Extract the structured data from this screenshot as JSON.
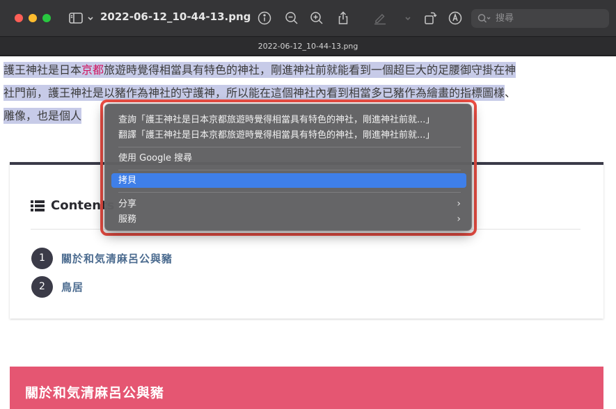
{
  "window": {
    "title": "2022-06-12_10-44-13.png",
    "tab_title": "2022-06-12_10-44-13.png"
  },
  "toolbar": {
    "icons": [
      "sidebar-icon",
      "chevron-down-icon",
      "info-icon",
      "zoom-out-icon",
      "zoom-in-icon",
      "share-icon",
      "markup-pen-icon",
      "chevron-down-icon",
      "rotate-icon",
      "markup-circle-icon"
    ],
    "search_placeholder": "搜尋"
  },
  "document": {
    "line1_hl_a": "護王神社是日本",
    "line1_kw": "京都",
    "line1_hl_b": "旅遊時覺得相當具有特色的神社，剛進神社前就能看到一個超巨大的足腰御守掛在神",
    "line2_hl": "社門前，護王神社是以豬作為神社的守護神，所以能在這個神社內看到相當多已豬作為繪畫的指標圖樣",
    "line2_tail": "、",
    "line3_hl": "雕像，也是個人",
    "toc": {
      "title": "Contents",
      "items": [
        {
          "number": "1",
          "label": "關於和気清麻呂公與豬"
        },
        {
          "number": "2",
          "label": "鳥居"
        }
      ]
    },
    "section_heading": "關於和気清麻呂公與豬"
  },
  "context_menu": {
    "lookup": "查詢「護王神社是日本京都旅遊時覺得相當具有特色的神社，剛進神社前就...」",
    "translate": "翻譯「護王神社是日本京都旅遊時覺得相當具有特色的神社，剛進神社前就...」",
    "google_search": "使用 Google 搜尋",
    "copy": "拷貝",
    "share": "分享",
    "services": "服務"
  },
  "colors": {
    "highlight_border": "#ef4e44",
    "menu_selected": "#3f7fe8",
    "selection": "#c7cbe8",
    "keyword": "#d0145f",
    "banner": "#e55672"
  }
}
